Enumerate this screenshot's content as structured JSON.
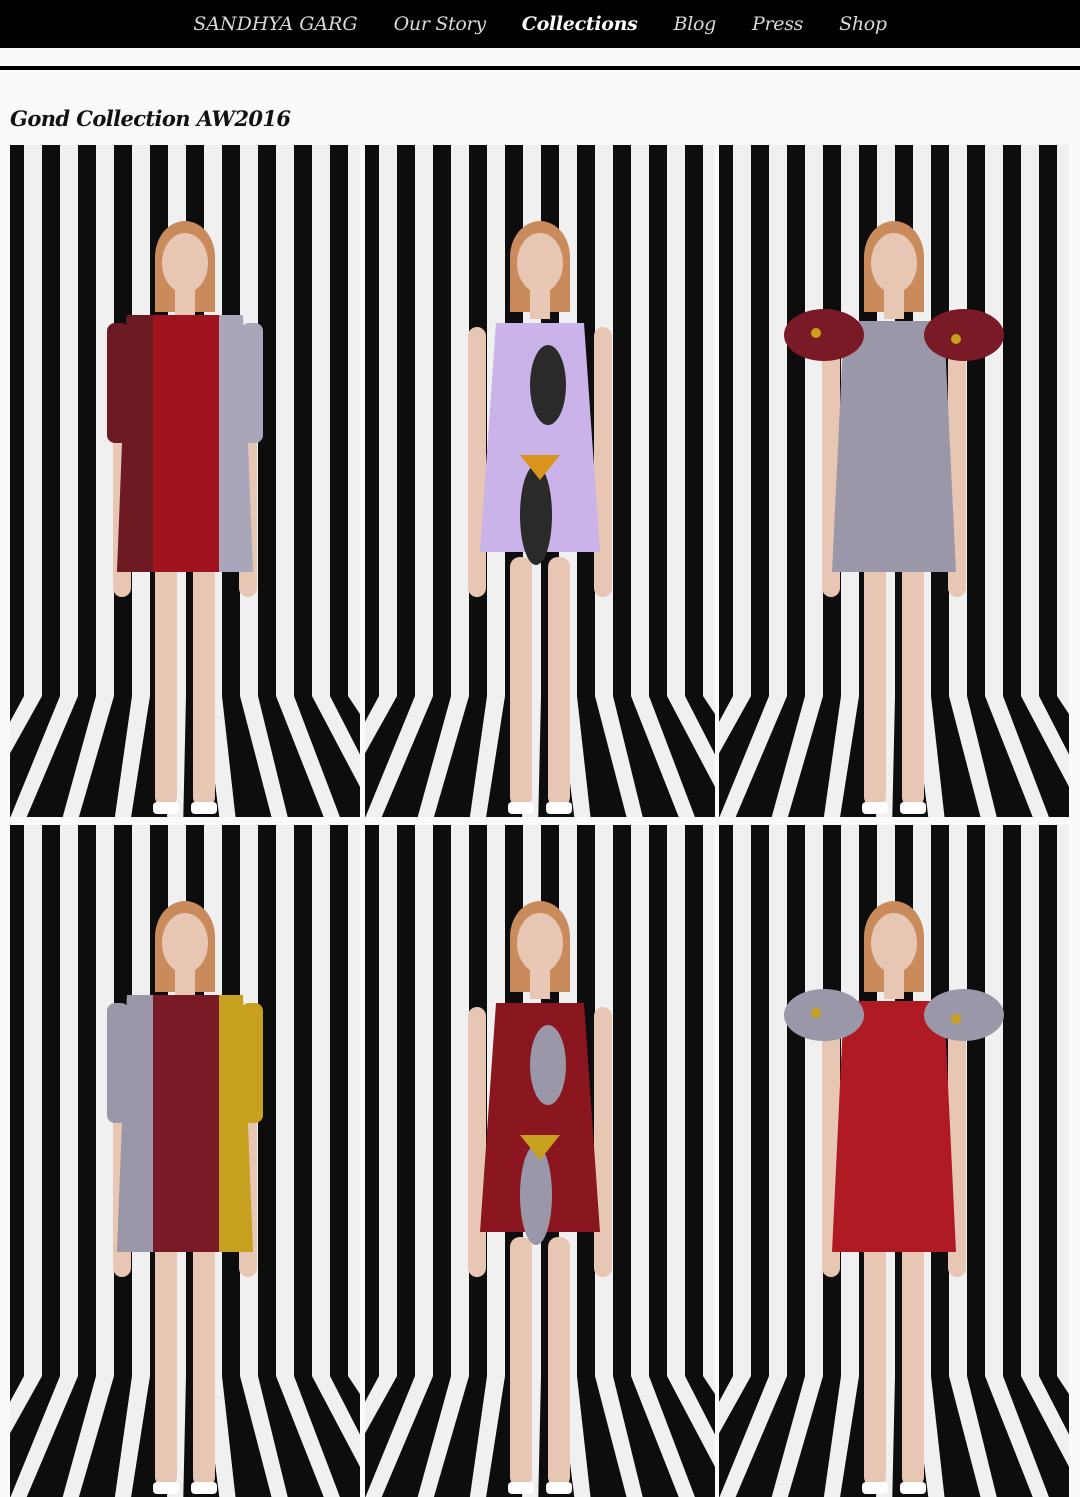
{
  "nav": {
    "brand": "SANDHYA GARG",
    "items": [
      {
        "label": "Our Story"
      },
      {
        "label": "Collections",
        "active": true
      },
      {
        "label": "Blog"
      },
      {
        "label": "Press"
      },
      {
        "label": "Shop"
      }
    ]
  },
  "page": {
    "title": "Gond Collection AW2016"
  },
  "gallery": {
    "photos": [
      {
        "name": "look-red-panel-dress",
        "dress_colors": [
          "#a0141f",
          "#6e1a22",
          "#a8a6b8"
        ]
      },
      {
        "name": "look-lilac-print-dress",
        "dress_colors": [
          "#c9b3e8",
          "#2a2a2a",
          "#d8941c"
        ]
      },
      {
        "name": "look-grey-ruffle-sleeve-dress",
        "dress_colors": [
          "#9a98a8",
          "#7a1a26",
          "#c8a020"
        ]
      },
      {
        "name": "look-4",
        "dress_colors": [
          "#7a1a26",
          "#9a98a8",
          "#c8a020"
        ]
      },
      {
        "name": "look-5",
        "dress_colors": [
          "#8a1620",
          "#9a98a8",
          "#c8a020"
        ]
      },
      {
        "name": "look-6",
        "dress_colors": [
          "#b01a22",
          "#9a98a8",
          "#c8a020"
        ]
      }
    ]
  },
  "colors": {
    "nav_bg": "#000000",
    "nav_text": "#d9d9d9",
    "page_bg": "#fafafa",
    "stripe_dark": "#0d0d0d",
    "stripe_light": "#f0f0f0",
    "skin": "#e8c6b4",
    "hair": "#c98b5c"
  }
}
